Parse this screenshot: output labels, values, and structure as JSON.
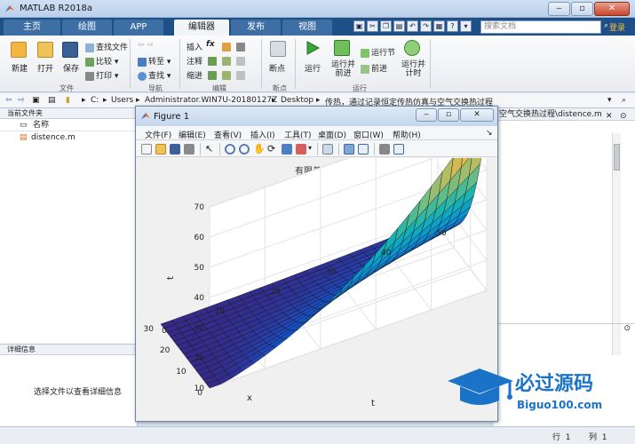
{
  "window": {
    "title": "MATLAB R2018a"
  },
  "tabs": [
    "主页",
    "绘图",
    "APP",
    "编辑器",
    "发布",
    "视图"
  ],
  "active_tab": "编辑器",
  "search": {
    "placeholder": "搜索文档"
  },
  "login_label": "登录",
  "ribbon": {
    "file": {
      "new": "新建",
      "open": "打开",
      "save": "保存",
      "find_files": "查找文件",
      "compare": "比较",
      "print": "打印",
      "label": "文件"
    },
    "navigate": {
      "goto": "转至",
      "find": "查找",
      "label": "导航"
    },
    "edit": {
      "insert": "插入",
      "comment": "注释",
      "indent": "缩进",
      "fx": "fx",
      "label": "编辑"
    },
    "breakpoints": {
      "breakpoints": "断点",
      "label": "断点"
    },
    "run": {
      "run": "运行",
      "run_advance": "运行并\n前进",
      "run_section": "运行节",
      "advance": "前进",
      "run_time": "运行并\n计时",
      "label": "运行"
    }
  },
  "path": {
    "segments": [
      "C:",
      "Users",
      "Administrator.WIN7U-20180127Z",
      "Desktop",
      "传热，通过记录恒定传热仿真与空气交换热过程"
    ]
  },
  "left_panel": {
    "title": "当前文件夹",
    "column_name": "名称",
    "files": [
      "distence.m"
    ],
    "details_title": "详细信息",
    "details_text": "选择文件以查看详细信息"
  },
  "editor_tab": "空气交换热过程\\distence.m",
  "status": {
    "line_label": "行",
    "line_value": "1",
    "col_label": "列",
    "col_value": "1"
  },
  "figure": {
    "title": "Figure 1",
    "menu": [
      "文件(F)",
      "编辑(E)",
      "查看(V)",
      "插入(I)",
      "工具(T)",
      "桌面(D)",
      "窗口(W)",
      "帮助(H)"
    ]
  },
  "chart_data": {
    "type": "surface",
    "title": "有限差法分解",
    "xlabel": "x",
    "ylabel": "t",
    "zlabel": "t",
    "x_ticks": [
      0,
      10,
      20,
      30
    ],
    "y_ticks": [
      0,
      10,
      20,
      30,
      40,
      50
    ],
    "z_ticks": [
      10,
      20,
      30,
      40,
      50,
      60,
      70
    ],
    "xlim": [
      0,
      30
    ],
    "ylim": [
      0,
      50
    ],
    "zlim": [
      10,
      70
    ],
    "colormap": "parula",
    "grid": true
  },
  "watermark": {
    "cn": "必过源码",
    "en": "Biguo100.com"
  }
}
